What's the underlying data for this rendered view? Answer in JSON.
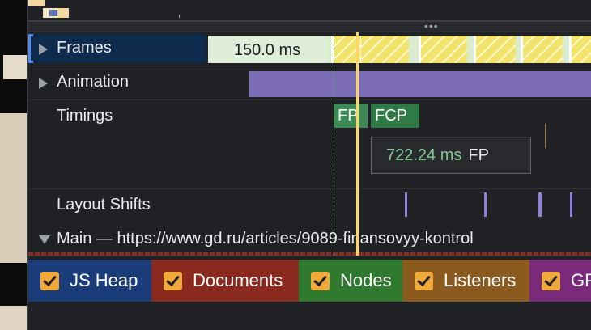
{
  "overview": {
    "more_icon": "more-horizontal-icon"
  },
  "tracks": {
    "frames": {
      "label": "Frames",
      "duration": "150.0 ms"
    },
    "animation": {
      "label": "Animation"
    },
    "timings": {
      "label": "Timings",
      "chips": [
        {
          "text": "FP",
          "color": "#3e8a57"
        },
        {
          "text": "FCP",
          "color": "#2f7a47"
        }
      ],
      "tooltip": {
        "time": "722.24 ms",
        "name": "FP"
      }
    },
    "layout_shifts": {
      "label": "Layout Shifts"
    },
    "main": {
      "label": "Main — https://www.gd.ru/articles/9089-finansovyy-kontrol"
    }
  },
  "counters": [
    {
      "label": "JS Heap",
      "color": "#1a3d7a",
      "checked": true
    },
    {
      "label": "Documents",
      "color": "#8a2a1e",
      "checked": true
    },
    {
      "label": "Nodes",
      "color": "#2f7a2e",
      "checked": true
    },
    {
      "label": "Listeners",
      "color": "#8a5a1e",
      "checked": true
    },
    {
      "label": "GPU Memory",
      "color": "#7a2a7a",
      "checked": true
    }
  ],
  "colors": {
    "accent_cursor": "#fdd663",
    "animation_bar": "#7c6bb5",
    "layout_shift": "#8f80e0",
    "checkbox": "#f2a93b"
  }
}
